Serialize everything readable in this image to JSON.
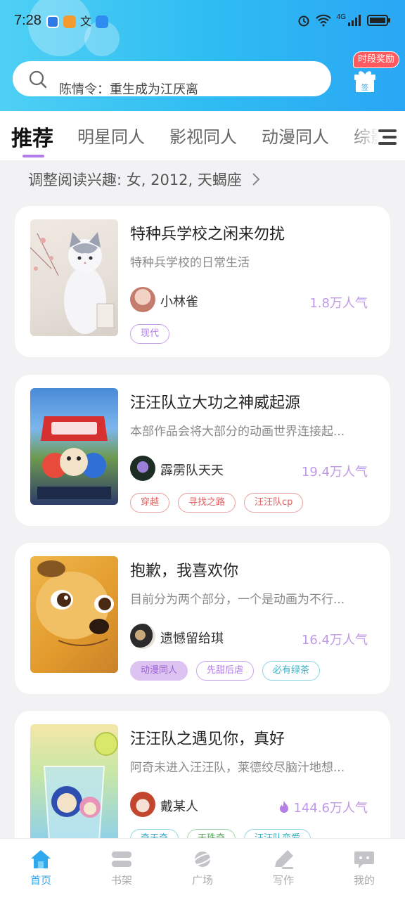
{
  "status_bar": {
    "time": "7:28",
    "network": "4G"
  },
  "search": {
    "placeholder": "陈情令：重生成为江厌离"
  },
  "reward": {
    "badge": "时段奖励",
    "gift_label": "签"
  },
  "tabs": [
    {
      "label": "推荐",
      "active": true
    },
    {
      "label": "明星同人",
      "active": false
    },
    {
      "label": "影视同人",
      "active": false
    },
    {
      "label": "动漫同人",
      "active": false
    },
    {
      "label": "综影",
      "active": false
    }
  ],
  "interest": {
    "text": "调整阅读兴趣: 女, 2012, 天蝎座"
  },
  "cards": [
    {
      "title": "特种兵学校之闲来勿扰",
      "desc": "特种兵学校的日常生活",
      "author": "小林雀",
      "popularity": "1.8万人气",
      "hot": false,
      "tags": [
        {
          "label": "现代",
          "style": "purple-outline"
        }
      ]
    },
    {
      "title": "汪汪队立大功之神威起源",
      "desc": "本部作品会将大部分的动画世界连接起...",
      "author": "霹雳队天天",
      "popularity": "19.4万人气",
      "hot": false,
      "tags": [
        {
          "label": "穿越",
          "style": "red-outline"
        },
        {
          "label": "寻找之路",
          "style": "red-outline"
        },
        {
          "label": "汪汪队cp",
          "style": "red-outline"
        }
      ]
    },
    {
      "title": "抱歉，我喜欢你",
      "desc": "目前分为两个部分，一个是动画为不行...",
      "author": "遗憾留给琪",
      "popularity": "16.4万人气",
      "hot": false,
      "tags": [
        {
          "label": "动漫同人",
          "style": "purple-filled"
        },
        {
          "label": "先甜后虐",
          "style": "purple-outline"
        },
        {
          "label": "必有绿茶",
          "style": "cyan-outline"
        }
      ]
    },
    {
      "title": "汪汪队之遇见你，真好",
      "desc": "阿奇未进入汪汪队，莱德绞尽脑汁地想...",
      "author": "戴某人",
      "popularity": "144.6万人气",
      "hot": true,
      "tags": [
        {
          "label": "奇天奇",
          "style": "cyan-outline"
        },
        {
          "label": "天珠奇",
          "style": "green-outline"
        },
        {
          "label": "汪汪队恋爱",
          "style": "cyan-outline"
        }
      ]
    }
  ],
  "bottom_nav": [
    {
      "label": "首页",
      "icon": "home-icon",
      "active": true
    },
    {
      "label": "书架",
      "icon": "bookshelf-icon",
      "active": false
    },
    {
      "label": "广场",
      "icon": "planet-icon",
      "active": false
    },
    {
      "label": "写作",
      "icon": "pen-icon",
      "active": false
    },
    {
      "label": "我的",
      "icon": "chat-bubble-icon",
      "active": false
    }
  ],
  "colors": {
    "accent": "#2fa8ee",
    "popularity": "#c099e6",
    "hot": "#b67fe6"
  }
}
